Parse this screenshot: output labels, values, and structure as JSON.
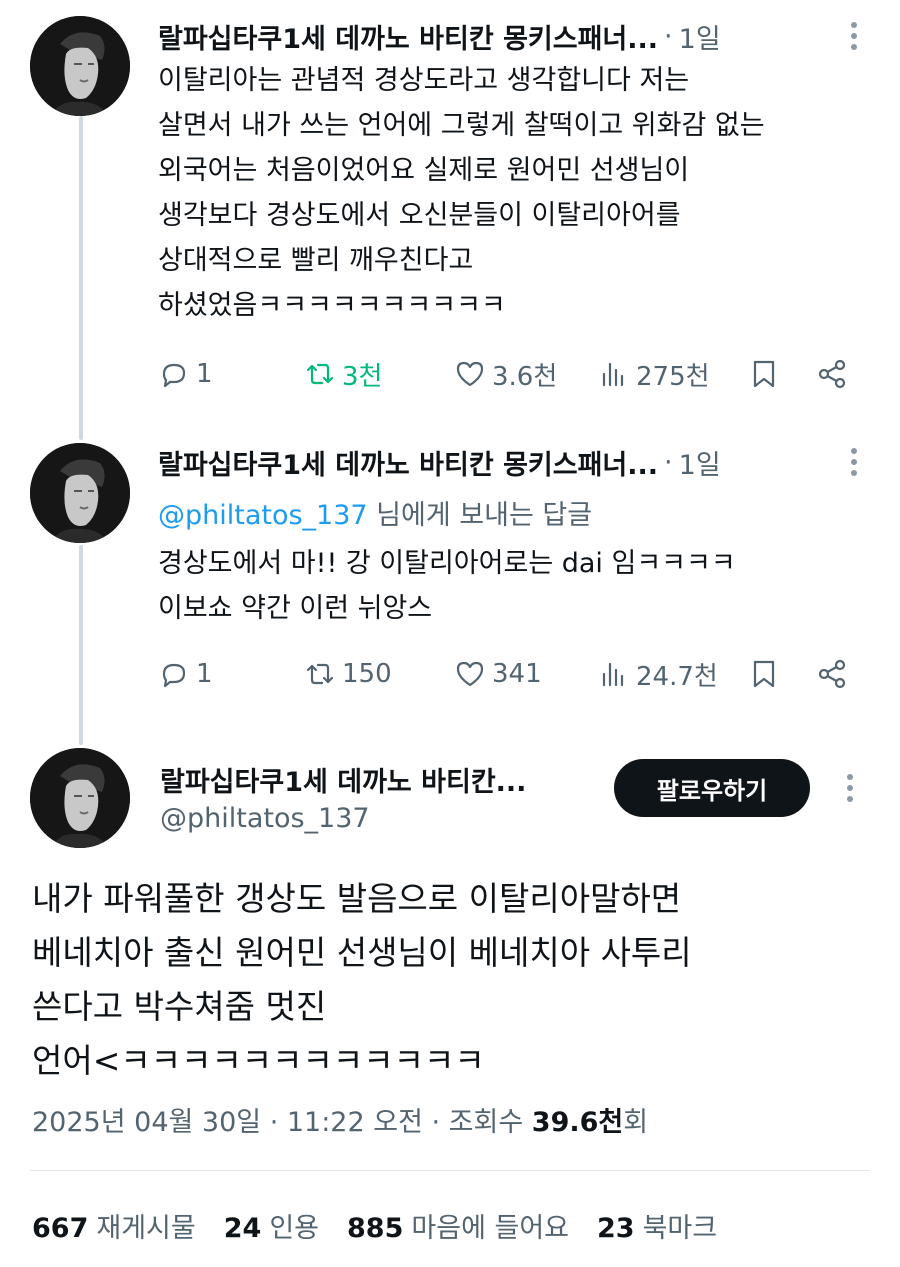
{
  "tweets": [
    {
      "author": "랄파십타쿠1세 데까노 바티칸 몽키스패너...",
      "time": "1일",
      "reply_prefix": "",
      "reply_handle": "",
      "reply_suffix": "",
      "text": "이탈리아는 관념적 경상도라고 생각합니다 저는\n살면서 내가 쓰는 언어에 그렇게 찰떡이고 위화감 없는\n외국어는 처음이었어요 실제로 원어민 선생님이\n생각보다 경상도에서 오신분들이 이탈리아어를\n상대적으로 빨리 깨우친다고\n하셨었음ㅋㅋㅋㅋㅋㅋㅋㅋㅋㅋ",
      "replies": "1",
      "retweets": "3천",
      "likes": "3.6천",
      "views": "275천"
    },
    {
      "author": "랄파십타쿠1세 데까노 바티칸 몽키스패너...",
      "time": "1일",
      "reply_handle": "@philtatos_137",
      "reply_suffix": " 님에게 보내는 답글",
      "text": "경상도에서 마!! 강 이탈리아어로는 dai 임ㅋㅋㅋㅋ\n이보쇼 약간 이런 뉘앙스",
      "replies": "1",
      "retweets": "150",
      "likes": "341",
      "views": "24.7천"
    }
  ],
  "main": {
    "author": "랄파십타쿠1세 데까노 바티칸...",
    "handle": "@philtatos_137",
    "follow_label": "팔로우하기",
    "text": "내가 파워풀한 갱상도 발음으로 이탈리아말하면\n베네치아 출신 원어민 선생님이 베네치아 사투리\n쓴다고 박수쳐줌 멋진\n언어<ㅋㅋㅋㅋㅋㅋㅋㅋㅋㅋㅋㅋ",
    "date": "2025년 04월 30일 · 11:22 오전 · 조회수 ",
    "views_value": "39.6천",
    "views_suffix": "회"
  },
  "stats": {
    "retweets_count": "667",
    "retweets_label": "재게시물",
    "quotes_count": "24",
    "quotes_label": "인용",
    "likes_count": "885",
    "likes_label": "마음에 들어요",
    "bookmarks_count": "23",
    "bookmarks_label": "북마크"
  },
  "colors": {
    "accent": "#1d9bf0",
    "retweet_active": "#00ba7c",
    "muted": "#536471",
    "text": "#0f1419",
    "button_bg": "#0f1419"
  },
  "icons": [
    "reply-icon",
    "retweet-icon",
    "like-icon",
    "views-icon",
    "bookmark-icon",
    "share-icon",
    "more-icon"
  ]
}
